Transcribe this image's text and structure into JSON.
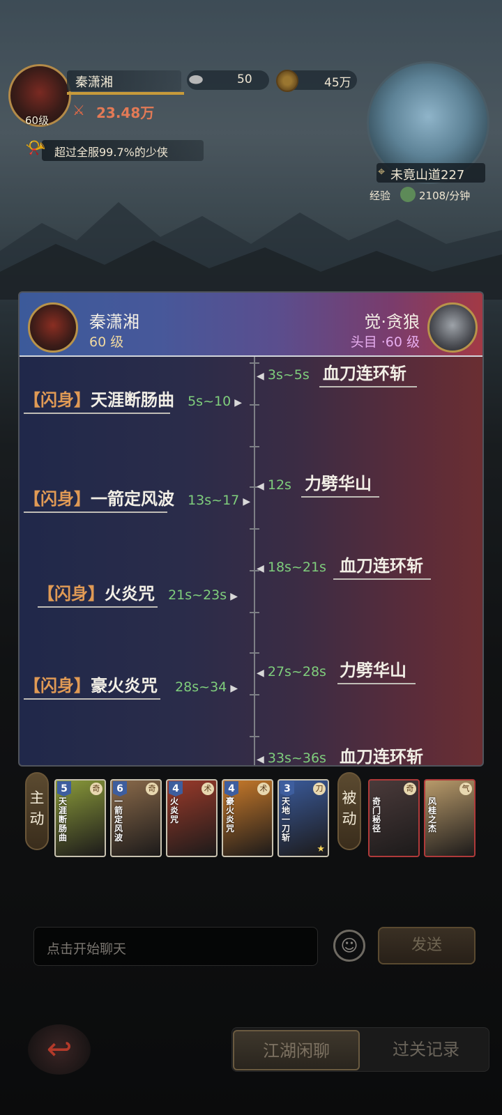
{
  "player": {
    "name": "秦潇湘",
    "level": "60级",
    "power": "23.48万",
    "resource_a": "50",
    "resource_b": "45万",
    "rank_text": "超过全服99.7%的少侠"
  },
  "map": {
    "location": "未竟山道227",
    "exp_label": "经验",
    "exp_rate": "2108/分钟"
  },
  "dialog": {
    "left_name": "秦潇湘",
    "left_level": "60 级",
    "right_name": "觉·贪狼",
    "right_level": "头目 ·60 级",
    "left_skills": [
      {
        "tag": "【闪身】",
        "name": "天涯断肠曲",
        "time": "5s~10"
      },
      {
        "tag": "【闪身】",
        "name": "一箭定风波",
        "time": "13s~17"
      },
      {
        "tag": "【闪身】",
        "name": "火炎咒",
        "time": "21s~23s"
      },
      {
        "tag": "【闪身】",
        "name": "豪火炎咒",
        "time": "28s~34"
      }
    ],
    "right_skills": [
      {
        "name": "血刀连环斩",
        "time": "3s~5s"
      },
      {
        "name": "力劈华山",
        "time": "12s"
      },
      {
        "name": "血刀连环斩",
        "time": "18s~21s"
      },
      {
        "name": "力劈华山",
        "time": "27s~28s"
      },
      {
        "name": "血刀连环斩",
        "time": "33s~36s"
      }
    ]
  },
  "cards": {
    "active_label": "主动",
    "passive_label": "被动",
    "active": [
      {
        "cost": "5",
        "name": "天涯断肠曲",
        "type": "奇",
        "color": "#8a9a3a"
      },
      {
        "cost": "6",
        "name": "一箭定风波",
        "type": "奇",
        "color": "#8a6a4a"
      },
      {
        "cost": "4",
        "name": "火炎咒",
        "type": "术",
        "color": "#9a3a2a"
      },
      {
        "cost": "4",
        "name": "豪火炎咒",
        "type": "术",
        "color": "#c87a2a"
      },
      {
        "cost": "3",
        "name": "天地一刀斩",
        "type": "刀",
        "color": "#3a5a9a"
      }
    ],
    "passive": [
      {
        "name": "奇门秘径",
        "type": "奇",
        "color": "#4a3a3a"
      },
      {
        "name": "风桂之杰",
        "type": "气",
        "color": "#b89a6a"
      }
    ]
  },
  "chat": {
    "placeholder": "点击开始聊天",
    "send_label": "发送"
  },
  "tabs": {
    "chat_label": "江湖闲聊",
    "record_label": "过关记录"
  }
}
